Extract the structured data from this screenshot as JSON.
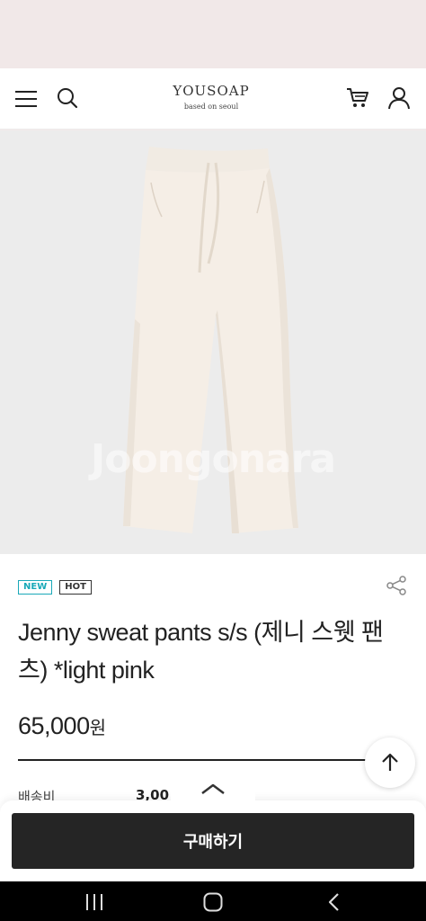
{
  "header": {
    "brand_name": "YOUSOAP",
    "brand_tagline": "based on seoul",
    "icons": [
      "hamburger-menu-icon",
      "search-icon",
      "cart-icon",
      "user-icon"
    ]
  },
  "product": {
    "watermark": "Joongonara",
    "badges": {
      "new": "NEW",
      "hot": "HOT"
    },
    "title": "Jenny sweat pants s/s (제니 스웻 팬츠) *light pink",
    "price": "65,000",
    "price_unit": "원",
    "shipping_label": "배송비",
    "shipping_value": "3,00"
  },
  "actions": {
    "buy_label": "구매하기"
  },
  "colors": {
    "accent_new": "#1aa9b8",
    "buy_button": "#252525",
    "image_bg": "#ececec",
    "product": "#f3ece4"
  }
}
